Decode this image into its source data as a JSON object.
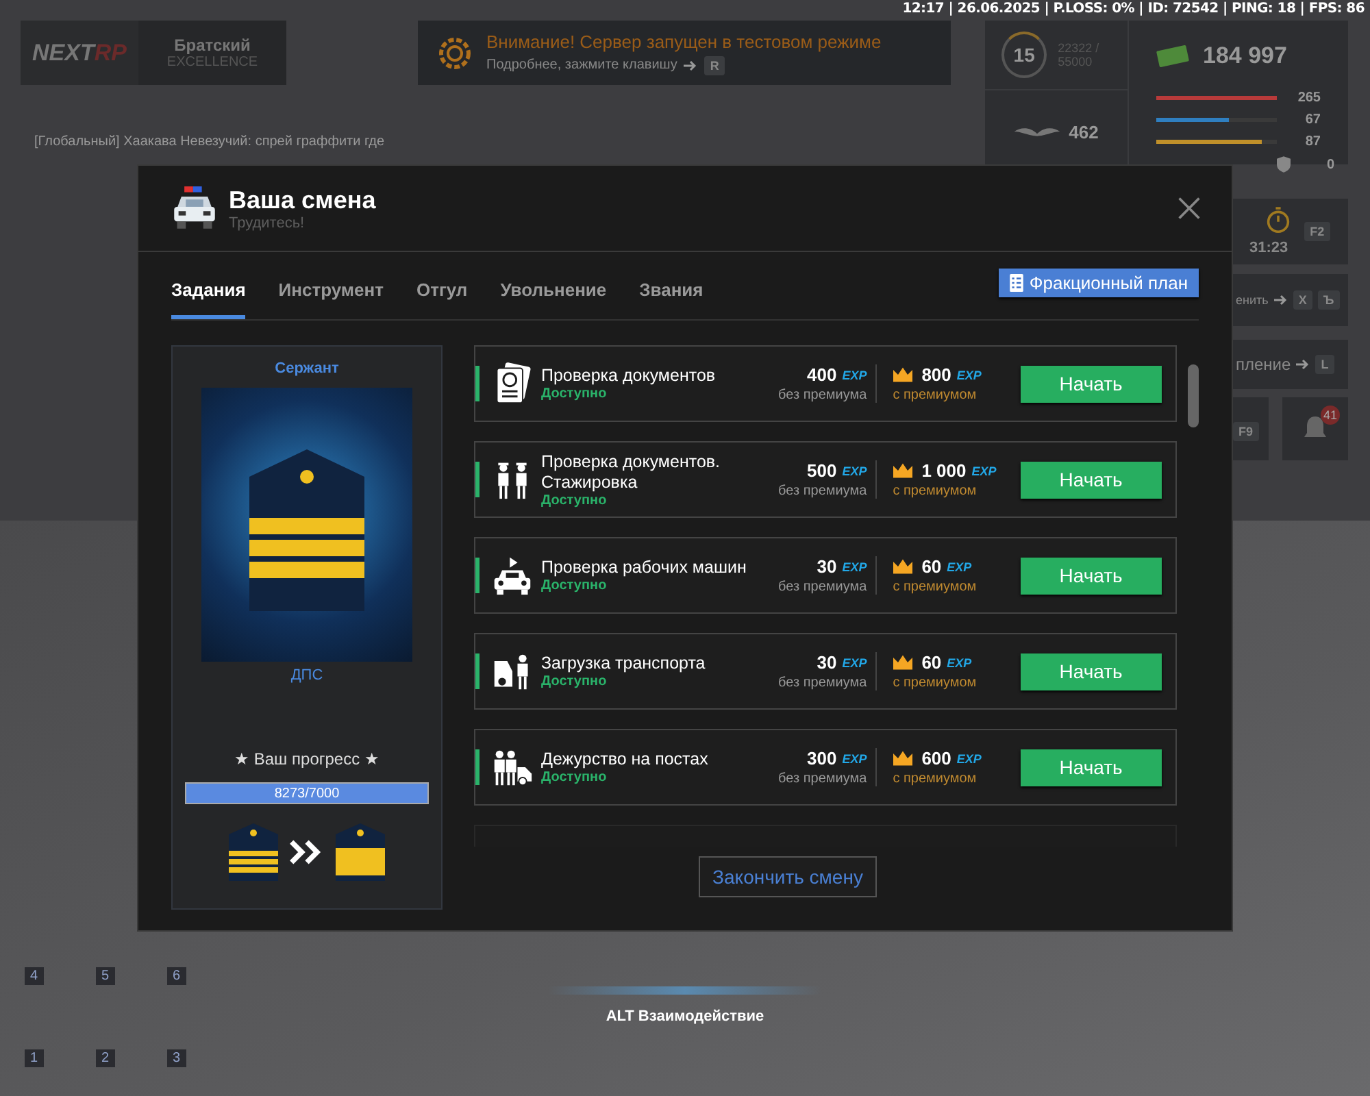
{
  "hud": {
    "status_line": "12:17 | 26.06.2025 | P.LOSS: 0% | ID: 72542 | PING: 18 | FPS: 86",
    "logo": {
      "part_1": "NEXT",
      "part_2": "RP"
    },
    "server": {
      "name": "Братский",
      "tier": "EXCELLENCE"
    },
    "notice": {
      "title": "Внимание! Сервер запущен в тестовом режиме",
      "hint": "Подробнее, зажмите клавишу",
      "key": "R"
    },
    "stats": {
      "level": "15",
      "xp": "22322 / 55000",
      "money": "184 997",
      "wings": "462",
      "armor": "0",
      "bars": [
        {
          "value": "265",
          "level": 1.0,
          "color": "#b83a3a"
        },
        {
          "value": "67",
          "level": 0.6,
          "color": "#2f7fc0"
        },
        {
          "value": "87",
          "level": 0.87,
          "color": "#c0902a"
        }
      ]
    },
    "side": {
      "timer": "31:23",
      "timer_key": "F2",
      "hint_1": "енить",
      "keys_1": [
        "X",
        "Ъ"
      ],
      "hint_2": "пление",
      "key_2": "L",
      "key_3": "F9",
      "notifications": "41"
    },
    "chat": [
      "[Глобальный] Хаакава Невезучий: спрей граффити где"
    ],
    "hotbar": [
      "4",
      "5",
      "6",
      "1",
      "2",
      "3"
    ],
    "interact": {
      "key": "ALT",
      "label": "Взаимодействие"
    }
  },
  "modal": {
    "title": "Ваша смена",
    "subtitle": "Трудитесь!",
    "tabs": [
      {
        "label": "Задания",
        "selected": true
      },
      {
        "label": "Инструмент",
        "selected": false
      },
      {
        "label": "Отгул",
        "selected": false
      },
      {
        "label": "Увольнение",
        "selected": false
      },
      {
        "label": "Звания",
        "selected": false
      }
    ],
    "plan_button": "Фракционный план",
    "rank": {
      "title": "Сержант",
      "unit": "ДПС",
      "progress_label": "★ Ваш прогресс ★",
      "progress": "8273/7000",
      "level": 1.0
    },
    "tasks": [
      {
        "kind": "documents",
        "title": "Проверка документов",
        "status": "Доступно",
        "available": true,
        "base_exp": "400",
        "premium_exp": "800",
        "exp_unit": "EXP",
        "premium_unit": "EXP",
        "base_note": "без премиума",
        "premium_note": "с премиумом",
        "button": "Начать"
      },
      {
        "kind": "trainees",
        "title": "Проверка документов. Стажировка",
        "status": "Доступно",
        "available": true,
        "base_exp": "500",
        "premium_exp": "1 000",
        "exp_unit": "EXP",
        "premium_unit": "EXP",
        "base_note": "без премиума",
        "premium_note": "с премиумом",
        "button": "Начать"
      },
      {
        "kind": "cars",
        "title": "Проверка рабочих машин",
        "status": "Доступно",
        "available": true,
        "base_exp": "30",
        "premium_exp": "60",
        "exp_unit": "EXP",
        "premium_unit": "EXP",
        "base_note": "без премиума",
        "premium_note": "с премиумом",
        "button": "Начать"
      },
      {
        "kind": "loading",
        "title": "Загрузка транспорта",
        "status": "Доступно",
        "available": true,
        "base_exp": "30",
        "premium_exp": "60",
        "exp_unit": "EXP",
        "premium_unit": "EXP",
        "base_note": "без премиума",
        "premium_note": "с премиумом",
        "button": "Начать"
      },
      {
        "kind": "posts",
        "title": "Дежурство на постах",
        "status": "Доступно",
        "available": true,
        "base_exp": "300",
        "premium_exp": "600",
        "exp_unit": "EXP",
        "premium_unit": "EXP",
        "base_note": "без премиума",
        "premium_note": "с премиумом",
        "button": "Начать"
      }
    ],
    "finish_button": "Закончить смену"
  }
}
